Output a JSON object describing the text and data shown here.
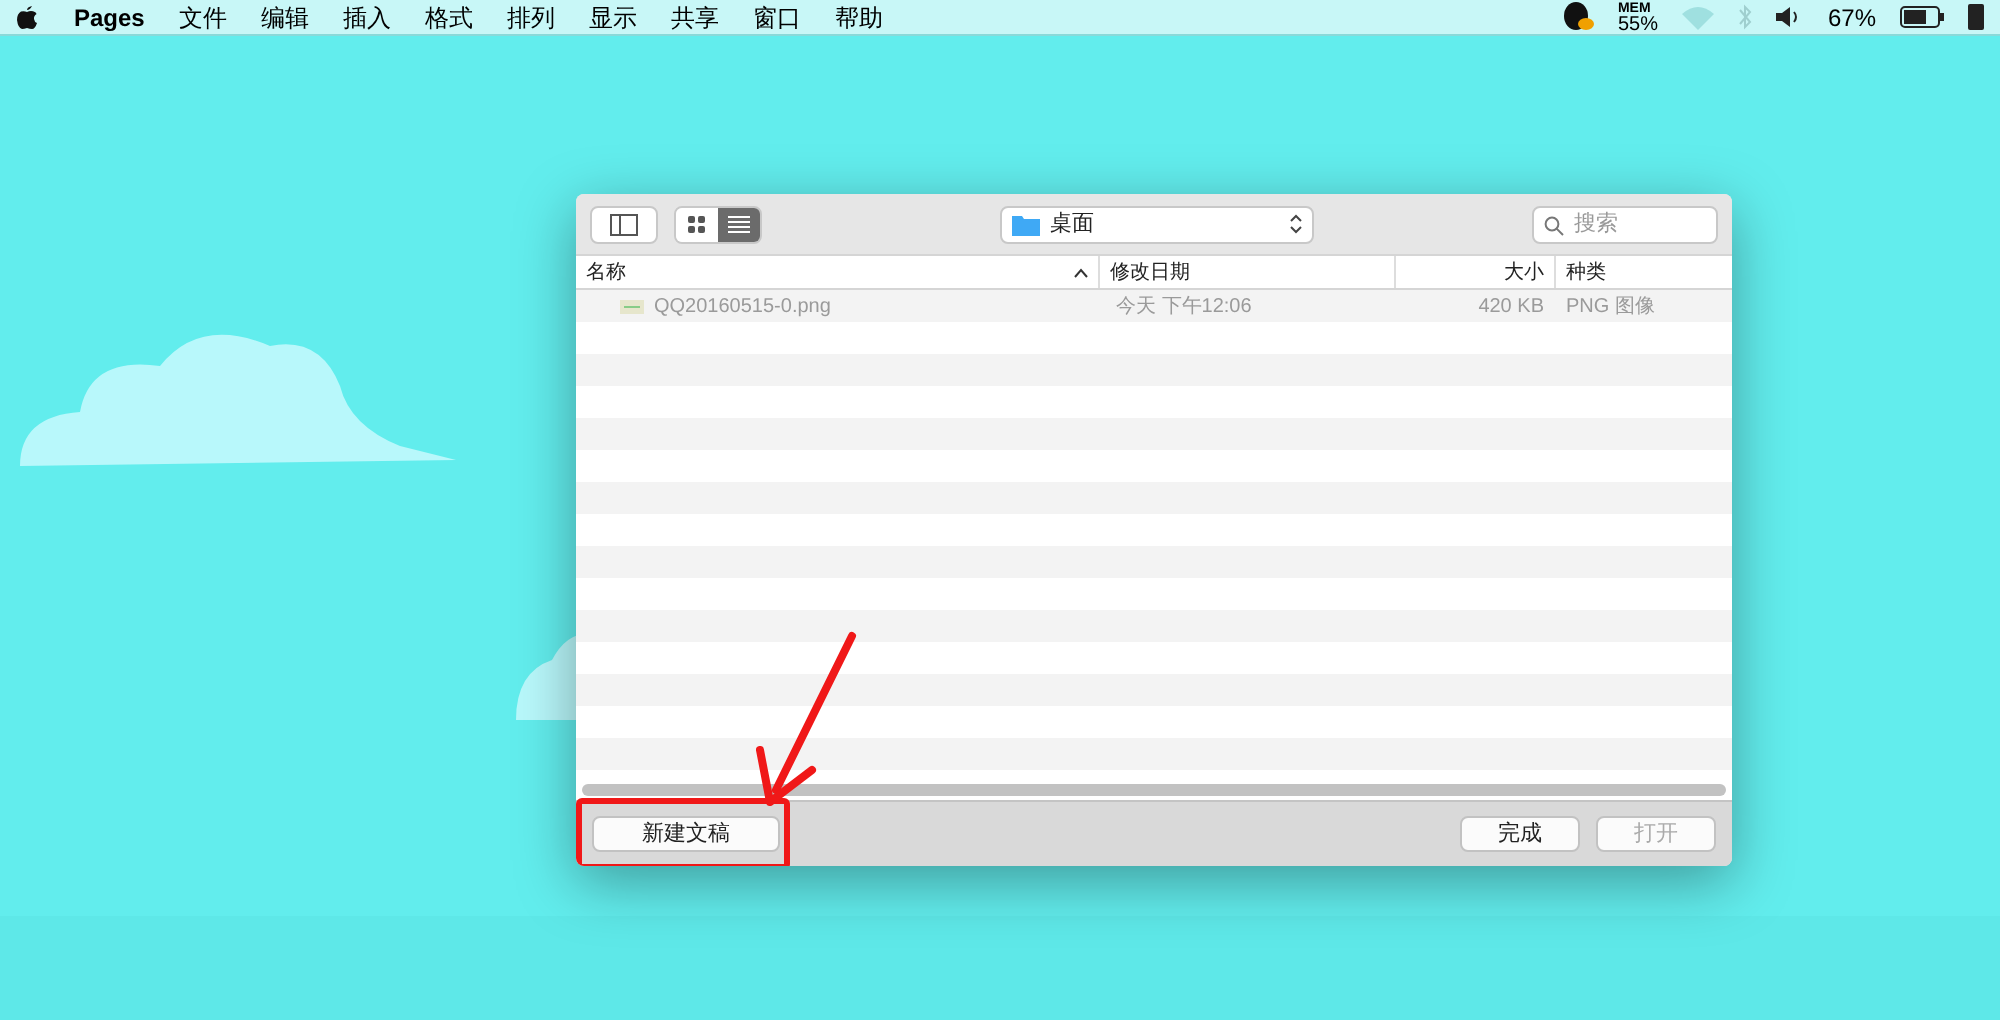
{
  "menubar": {
    "app": "Pages",
    "menus": [
      "文件",
      "编辑",
      "插入",
      "格式",
      "排列",
      "显示",
      "共享",
      "窗口",
      "帮助"
    ],
    "mem_label": "MEM",
    "mem_value": "55%",
    "battery": "67%"
  },
  "dialog": {
    "view_modes": [
      {
        "kind": "icons",
        "selected": false
      },
      {
        "kind": "list",
        "selected": true
      }
    ],
    "location": "桌面",
    "search_placeholder": "搜索",
    "columns": [
      {
        "label": "名称",
        "sorted": true
      },
      {
        "label": "修改日期",
        "sorted": false
      },
      {
        "label": "大小",
        "sorted": false
      },
      {
        "label": "种类",
        "sorted": false
      }
    ],
    "rows": [
      {
        "name": "QQ20160515-0.png",
        "date": "今天 下午12:06",
        "size": "420 KB",
        "kind": "PNG 图像",
        "disabled": true
      }
    ],
    "buttons": [
      {
        "label": "新建文稿",
        "disabled": false,
        "highlighted": true
      },
      {
        "label": "完成",
        "disabled": false,
        "highlighted": false
      },
      {
        "label": "打开",
        "disabled": true,
        "highlighted": false
      }
    ]
  }
}
